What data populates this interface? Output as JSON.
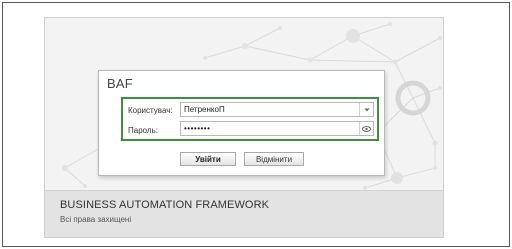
{
  "dialog": {
    "title": "BAF",
    "user_label": "Користувач:",
    "user_value": "ПетренкоП",
    "password_label": "Пароль:",
    "password_value": "••••••••",
    "login_button": "Увійти",
    "cancel_button": "Відмінити"
  },
  "footer": {
    "title": "BUSINESS AUTOMATION FRAMEWORK",
    "subtitle": "Всі права захищені"
  },
  "colors": {
    "highlight_border": "#3f8f3f",
    "background": "#f3f3f3",
    "footer_background": "#e3e3e3"
  },
  "icons": {
    "user_dropdown": "chevron-down-icon",
    "password_toggle": "eye-icon"
  }
}
